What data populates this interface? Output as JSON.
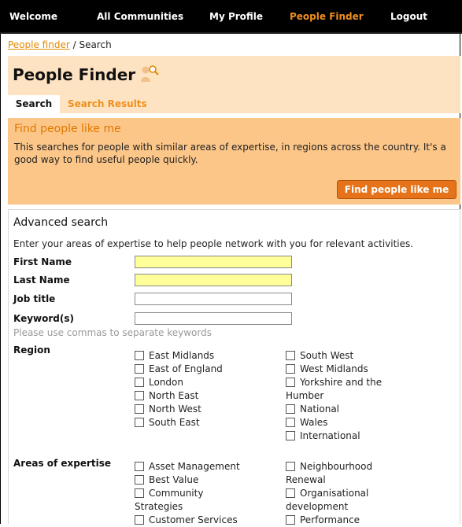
{
  "nav": {
    "items": [
      {
        "label": "Welcome"
      },
      {
        "label": "All Communities"
      },
      {
        "label": "My Profile"
      },
      {
        "label": "People Finder",
        "active": true
      },
      {
        "label": "Logout"
      }
    ]
  },
  "breadcrumb": {
    "link": "People finder",
    "separator": " / ",
    "current": "Search"
  },
  "header": {
    "title": "People Finder",
    "icon": "person-search-icon",
    "tabs": [
      {
        "label": "Search",
        "active": true
      },
      {
        "label": "Search Results"
      }
    ]
  },
  "likeme": {
    "heading": "Find people like me",
    "text": "This searches for people with similar areas of expertise, in regions across the country. It's a good way to find useful people quickly.",
    "button": "Find people like me"
  },
  "advanced": {
    "heading": "Advanced search",
    "intro": "Enter your areas of expertise to help people network with you for relevant activities.",
    "fields": {
      "first_name": {
        "label": "First Name",
        "value": ""
      },
      "last_name": {
        "label": "Last Name",
        "value": ""
      },
      "job_title": {
        "label": "Job title",
        "value": ""
      },
      "keywords": {
        "label": "Keyword(s)",
        "value": ""
      }
    },
    "hint": "Please use commas to separate keywords",
    "region": {
      "label": "Region",
      "col1": [
        "East Midlands",
        "East of England",
        "London",
        "North East",
        "North West",
        "South East"
      ],
      "col2": [
        "South West",
        "West Midlands",
        "Yorkshire and the Humber",
        "National",
        "Wales",
        "International"
      ]
    },
    "expertise": {
      "label": "Areas of expertise",
      "col1": [
        "Asset Management",
        "Best Value",
        "Community Strategies",
        "Customer Services"
      ],
      "col2": [
        "Neighbourhood Renewal",
        "Organisational development",
        "Performance"
      ]
    }
  },
  "colors": {
    "accent": "#f08f1e",
    "band": "#fde3c1",
    "likeme_bg": "#fcc688",
    "button": "#e6731a",
    "highlight": "#ffff99"
  }
}
